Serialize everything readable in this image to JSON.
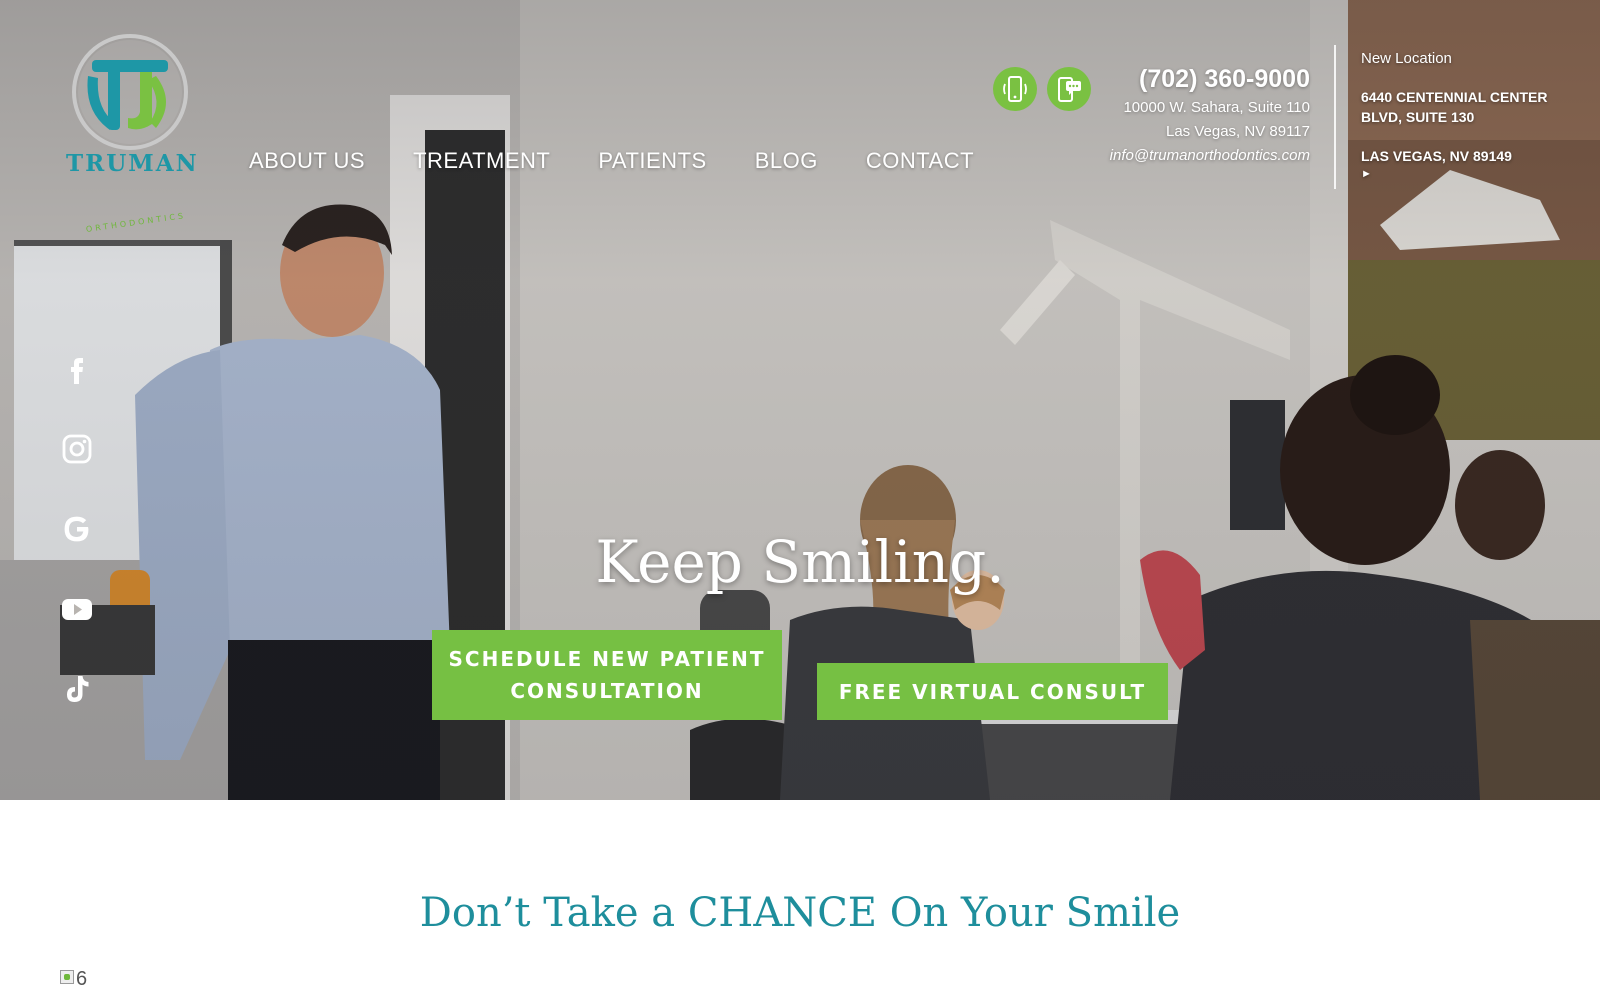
{
  "brand": {
    "logo_word": "TRUMAN",
    "logo_sub": "ORTHODONTICS",
    "teal": "#1e97a6",
    "green": "#7ac142"
  },
  "nav": {
    "items": [
      "ABOUT US",
      "TREATMENT",
      "PATIENTS",
      "BLOG",
      "CONTACT"
    ]
  },
  "contact": {
    "phone_icon": "mobile-phone-icon",
    "text_icon": "text-message-icon",
    "phone": "(702) 360-9000",
    "address_line1": "10000 W. Sahara, Suite 110",
    "address_line2": "Las Vegas, NV 89117",
    "email": "info@trumanorthodontics.com"
  },
  "new_location": {
    "label": "New Location",
    "street": "6440 CENTENNIAL CENTER BLVD, SUITE 130",
    "city": "LAS VEGAS, NV 89149",
    "arrow_icon": "caret-right-icon"
  },
  "social": [
    "facebook-icon",
    "instagram-icon",
    "google-icon",
    "youtube-icon",
    "tiktok-icon"
  ],
  "hero": {
    "headline": "Keep Smiling.",
    "cta_primary": "SCHEDULE NEW PATIENT CONSULTATION",
    "cta_secondary": "FREE VIRTUAL CONSULT"
  },
  "section": {
    "title": "Don’t Take a CHANCE On Your Smile",
    "broken_image_alt": "6"
  }
}
